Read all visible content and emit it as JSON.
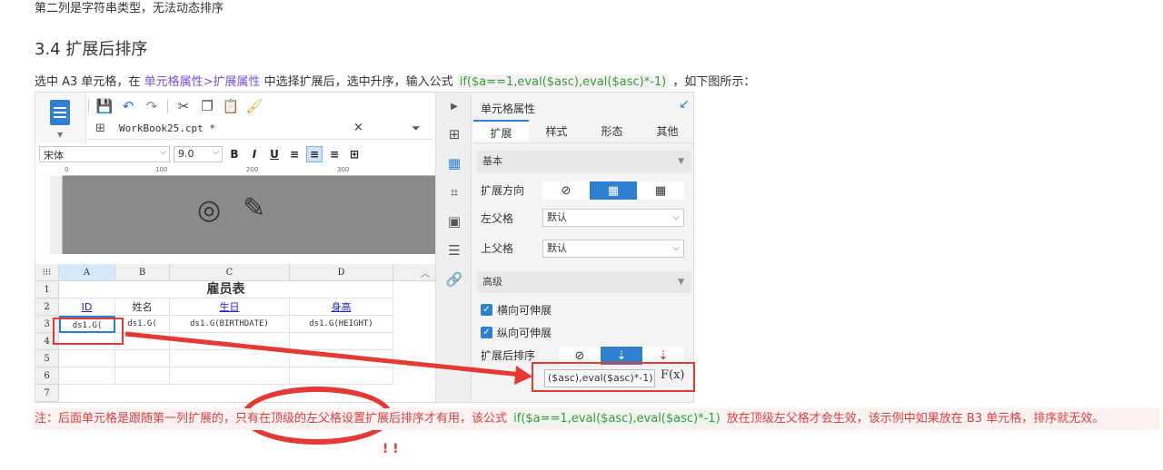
{
  "doc": {
    "top_line": "第二列是字符串类型，无法动态排序",
    "heading": "3.4 扩展后排序",
    "intro_a": "选中 A3 单元格，在 ",
    "intro_link": "单元格属性>扩展属性",
    "intro_b": " 中选择扩展后，选中升序，输入公式 ",
    "intro_code": "if($a==1,eval($asc),eval($asc)*-1)",
    "intro_c": " ，如下图所示：",
    "note_a": "注：后面单元格是跟随第一列扩展的，只有在顶级的左父格设置扩展后排序才有用，该公式 ",
    "note_code": "if($a==1,eval($asc),eval($asc)*-1)",
    "note_b": " 放在顶级左父格才会生效，该示例中如果放在 B3 单元格，排序就无效。",
    "bang": "! !"
  },
  "designer": {
    "tab_label": "WorkBook25.cpt *",
    "font_name": "宋体",
    "font_size": "9.0",
    "ruler_marks": [
      "0",
      "100",
      "200",
      "300"
    ],
    "columns": [
      "A",
      "B",
      "C",
      "D"
    ],
    "rows": [
      "1",
      "2",
      "3",
      "4",
      "5",
      "6",
      "7"
    ],
    "table_title": "雇员表",
    "headers": [
      "ID",
      "姓名",
      "生日",
      "身高"
    ],
    "cells_row3": [
      "ds1.G(",
      "ds1.G(",
      "ds1.G(BIRTHDATE)",
      "ds1.G(HEIGHT)"
    ]
  },
  "props": {
    "title": "单元格属性",
    "tabs": [
      "扩展",
      "样式",
      "形态",
      "其他"
    ],
    "section_basic": "基本",
    "expand_dir_label": "扩展方向",
    "left_parent_label": "左父格",
    "left_parent_value": "默认",
    "top_parent_label": "上父格",
    "top_parent_value": "默认",
    "section_advanced": "高级",
    "h_expand": "横向可伸展",
    "v_expand": "纵向可伸展",
    "sort_label": "扩展后排序",
    "formula_value": "($asc),eval($asc)*-1)",
    "fx_label": "F(x)"
  },
  "colors": {
    "accent": "#2f80d1",
    "annotation_red": "#e53935",
    "note_red": "#d94141",
    "code_green": "#3a9a3a"
  }
}
